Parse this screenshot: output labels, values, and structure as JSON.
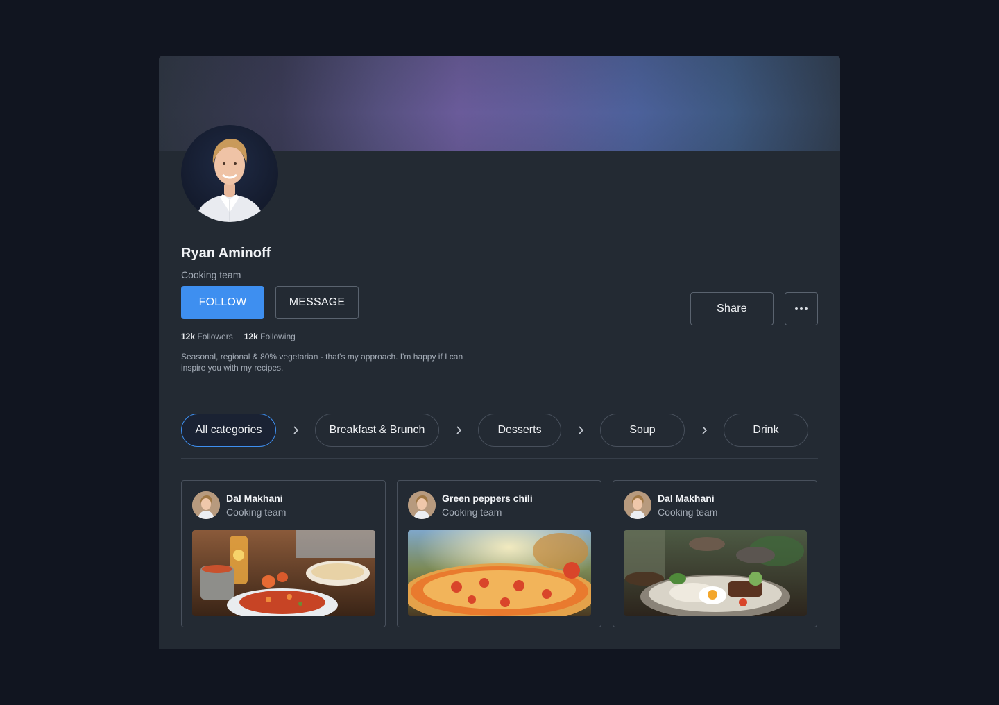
{
  "profile": {
    "name": "Ryan Aminoff",
    "role": "Cooking team",
    "follow_label": "FOLLOW",
    "message_label": "MESSAGE",
    "share_label": "Share",
    "followers_count": "12k",
    "followers_label": "Followers",
    "following_count": "12k",
    "following_label": "Following",
    "bio": "Seasonal, regional & 80% vegetarian - that's my approach. I'm happy if I can inspire you with my recipes."
  },
  "categories": [
    {
      "label": "All categories",
      "active": true
    },
    {
      "label": "Breakfast & Brunch",
      "active": false
    },
    {
      "label": "Desserts",
      "active": false
    },
    {
      "label": "Soup",
      "active": false
    },
    {
      "label": "Drink",
      "active": false
    }
  ],
  "posts": [
    {
      "title": "Dal Makhani",
      "subtitle": "Cooking team"
    },
    {
      "title": "Green peppers chili",
      "subtitle": "Cooking team"
    },
    {
      "title": "Dal Makhani",
      "subtitle": "Cooking team"
    }
  ],
  "colors": {
    "background": "#111520",
    "card": "#232a33",
    "accent": "#3e8ff0",
    "border": "#48505c",
    "muted_text": "#a5adb8"
  },
  "icons": {
    "more": "more-horizontal-icon",
    "chevron": "chevron-right-icon"
  }
}
